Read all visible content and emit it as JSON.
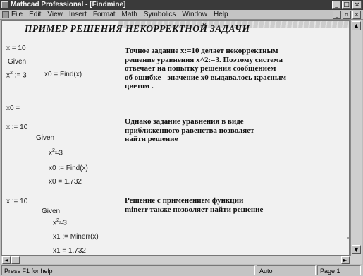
{
  "window": {
    "title": "Mathcad Professional - [Findmine]",
    "buttons": {
      "minimize": "_",
      "maximize": "□",
      "close": "×"
    }
  },
  "menu": {
    "items": [
      "File",
      "Edit",
      "View",
      "Insert",
      "Format",
      "Math",
      "Symbolics",
      "Window",
      "Help"
    ],
    "doc_buttons": {
      "minimize": "_",
      "restore": "▫",
      "close": "×"
    }
  },
  "document": {
    "heading": "ПРИМЕР РЕШЕНИЯ НЕКОРРЕКТНОЙ ЗАДАЧИ",
    "block1": {
      "init": "x = 10",
      "given": "Given",
      "equation": "x",
      "exponent": "2",
      "rhs": " := 3",
      "find": "x0 = Find(x)",
      "result": "x0 ="
    },
    "note1": "Точное задание x:=10 делает некорректным\nрешение уравнения x^2:=3. Поэтому система\nотвечает на попытку решения сообщением\nоб ошибке - значение x0 выдавалось красным\nцветом .",
    "block2": {
      "init": "x := 10",
      "given": "Given",
      "equation": "x",
      "exponent": "2",
      "rhs": "≈3",
      "find": "x0 := Find(x)",
      "result": "x0 = 1.732"
    },
    "note2": "Однако задание уравнения в виде\nприближенного равенства позволяет\nнайти решение",
    "block3": {
      "init": "x := 10",
      "given": "Given",
      "equation": "x",
      "exponent": "2",
      "rhs": "≈3",
      "find": "x1 := Minerr(x)",
      "result": "x1 = 1.732"
    },
    "note3": "Решение с применением функции\nminerr также позволяет найти решение",
    "cursor": "+"
  },
  "scrollbars": {
    "up": "▲",
    "down": "▼",
    "left": "◄",
    "right": "►"
  },
  "status": {
    "help": "Press F1 for help",
    "mode": "Auto",
    "page": "Page 1"
  }
}
